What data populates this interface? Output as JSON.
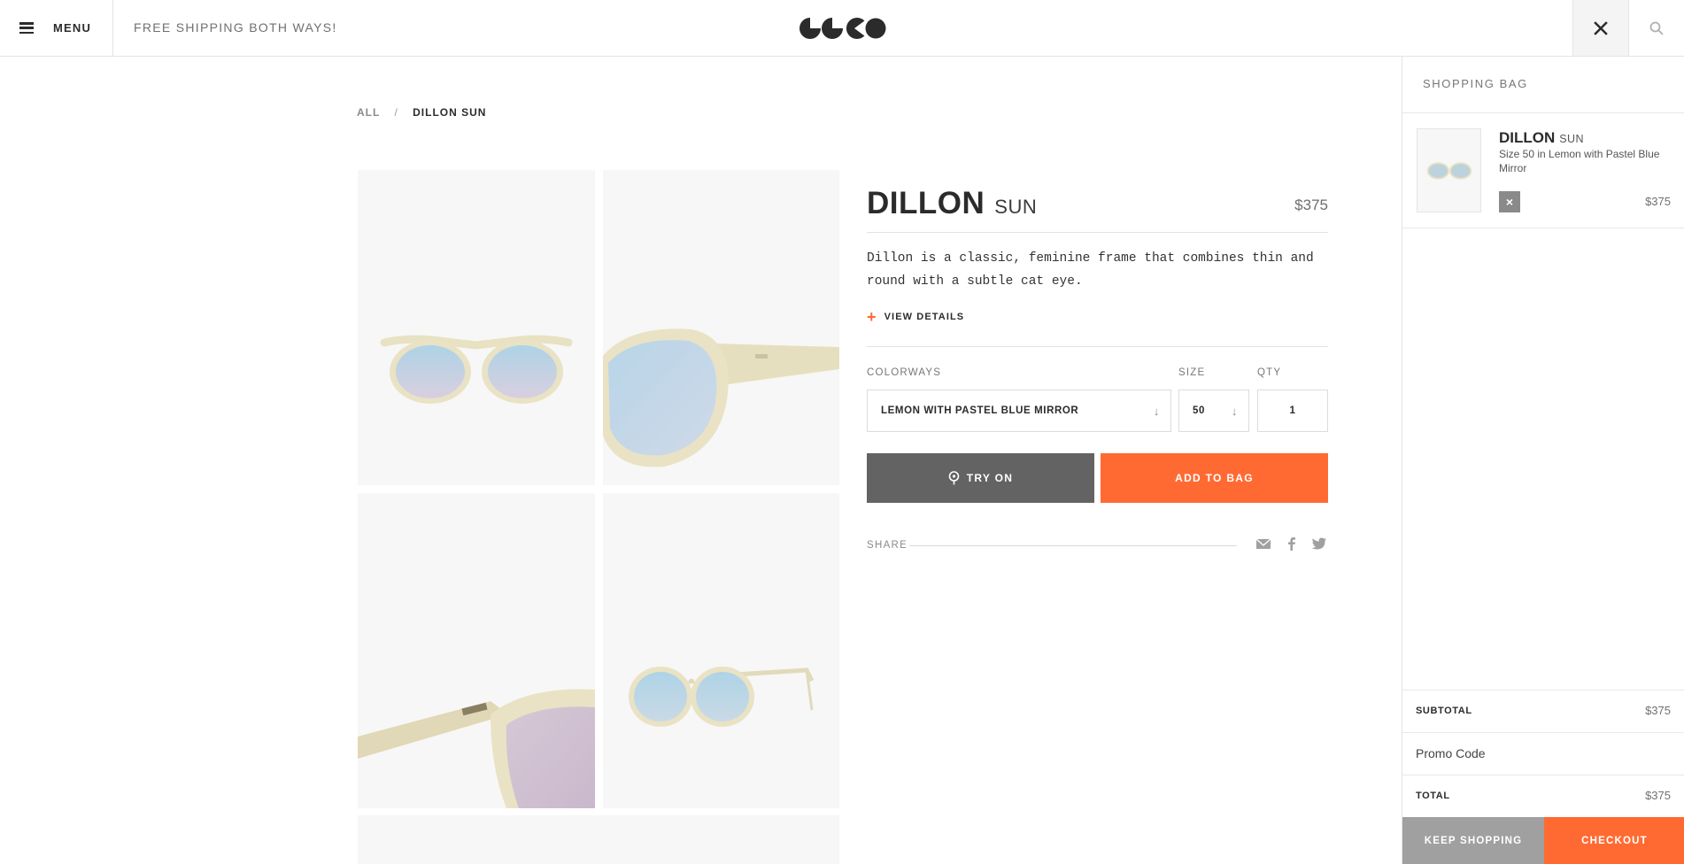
{
  "header": {
    "menu_label": "MENU",
    "promo_text": "FREE SHIPPING BOTH WAYS!",
    "logo_alt": "GLCO"
  },
  "breadcrumb": {
    "root": "ALL",
    "separator": "/",
    "current": "DILLON SUN"
  },
  "product": {
    "name": "DILLON",
    "type": "SUN",
    "price": "$375",
    "description": "Dillon is a classic, feminine frame that combines thin and round with a subtle cat eye.",
    "view_details": "VIEW DETAILS",
    "colorways_label": "COLORWAYS",
    "size_label": "SIZE",
    "qty_label": "QTY",
    "colorway_value": "LEMON WITH PASTEL BLUE MIRROR",
    "size_value": "50",
    "qty_value": "1",
    "try_on_label": "TRY ON",
    "add_to_bag_label": "ADD TO BAG",
    "share_label": "SHARE"
  },
  "bag": {
    "title": "SHOPPING BAG",
    "items": [
      {
        "name": "DILLON",
        "type": "SUN",
        "description": "Size 50 in Lemon with Pastel Blue Mirror",
        "price": "$375",
        "remove": "×"
      }
    ],
    "subtotal_label": "SUBTOTAL",
    "subtotal_value": "$375",
    "promo_label": "Promo Code",
    "total_label": "TOTAL",
    "total_value": "$375",
    "keep_shopping_label": "KEEP SHOPPING",
    "checkout_label": "CHECKOUT"
  },
  "icons": [
    "hamburger-icon",
    "close-icon",
    "search-icon",
    "plus-icon",
    "chevron-down-icon",
    "location-pin-icon",
    "email-icon",
    "facebook-icon",
    "twitter-icon"
  ],
  "colors": {
    "accent": "#ff6a33",
    "dark_button": "#636363",
    "muted_button": "#a0a0a0",
    "frame": "#ece5c6",
    "lens": "#b9d6e6"
  }
}
